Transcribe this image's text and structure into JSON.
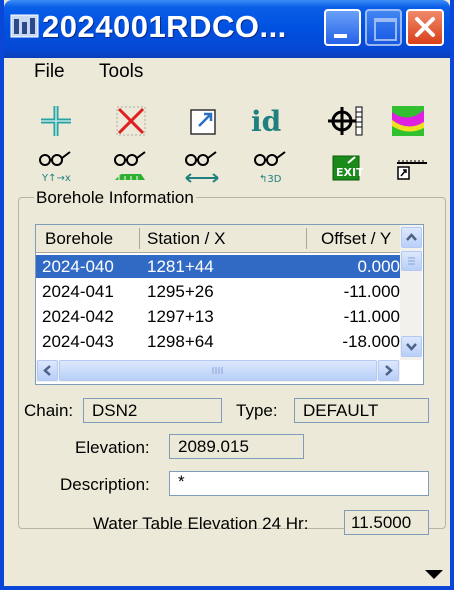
{
  "window": {
    "title": "2024001RDCO...",
    "title_icon": "microstation-icon"
  },
  "menu": [
    {
      "label": "File"
    },
    {
      "label": "Tools"
    }
  ],
  "toolbar": [
    {
      "icon": "add-crosshair-icon"
    },
    {
      "icon": "delete-x-icon"
    },
    {
      "icon": "zoom-window-icon"
    },
    {
      "icon": "identify-id-icon"
    },
    {
      "icon": "locate-target-icon"
    },
    {
      "icon": "color-profile-icon"
    },
    {
      "icon": "view-yx-icon"
    },
    {
      "icon": "view-plan-icon"
    },
    {
      "icon": "view-offset-icon"
    },
    {
      "icon": "view-3d-icon"
    },
    {
      "icon": "exit-icon"
    },
    {
      "icon": "settings-ruler-icon"
    }
  ],
  "borehole_group": {
    "label": "Borehole Information",
    "columns": [
      "Borehole",
      "Station / X",
      "Offset / Y"
    ],
    "rows": [
      {
        "borehole": "2024-040",
        "station": "1281+44",
        "offset": "0.000",
        "selected": true
      },
      {
        "borehole": "2024-041",
        "station": "1295+26",
        "offset": "-11.000",
        "selected": false
      },
      {
        "borehole": "2024-042",
        "station": "1297+13",
        "offset": "-11.000",
        "selected": false
      },
      {
        "borehole": "2024-043",
        "station": "1298+64",
        "offset": "-18.000",
        "selected": false
      }
    ]
  },
  "details": {
    "chain_label": "Chain:",
    "chain_value": "DSN2",
    "type_label": "Type:",
    "type_value": "DEFAULT",
    "elevation_label": "Elevation:",
    "elevation_value": "2089.015",
    "description_label": "Description:",
    "description_value": "*",
    "water_label": "Water Table Elevation 24 Hr:",
    "water_value": "11.5000"
  }
}
